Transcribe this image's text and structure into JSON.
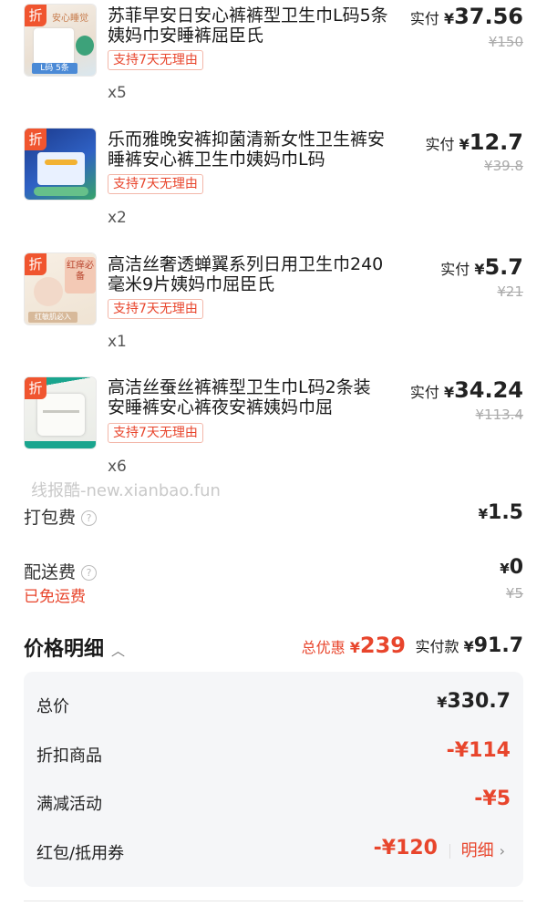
{
  "items": [
    {
      "title": "苏菲早安日安心裤裤型卫生巾L码5条姨妈巾安睡裤屈臣氏",
      "tag": "支持7天无理由",
      "qty": "x5",
      "paid_label": "实付",
      "currency": "¥",
      "paid": "37.56",
      "original": "¥150",
      "badge": "折",
      "thumb_text": "安心睡觉",
      "thumb_sub": "L码 5条"
    },
    {
      "title": "乐而雅晚安裤抑菌清新女性卫生裤安睡裤安心裤卫生巾姨妈巾L码",
      "tag": "支持7天无理由",
      "qty": "x2",
      "paid_label": "实付",
      "currency": "¥",
      "paid": "12.7",
      "original": "¥39.8",
      "badge": "折",
      "thumb_text": "",
      "thumb_sub": ""
    },
    {
      "title": "高洁丝奢透蝉翼系列日用卫生巾240毫米9片姨妈巾屈臣氏",
      "tag": "支持7天无理由",
      "qty": "x1",
      "paid_label": "实付",
      "currency": "¥",
      "paid": "5.7",
      "original": "¥21",
      "badge": "折",
      "thumb_text": "红痒必备",
      "thumb_sub": "红敏肌必入"
    },
    {
      "title": "高洁丝蚕丝裤裤型卫生巾L码2条装 安睡裤安心裤夜安裤姨妈巾屈",
      "tag": "支持7天无理由",
      "qty": "x6",
      "paid_label": "实付",
      "currency": "¥",
      "paid": "34.24",
      "original": "¥113.4",
      "badge": "折",
      "thumb_text": "",
      "thumb_sub": ""
    }
  ],
  "watermark": "线报酷-new.xianbao.fun",
  "packing_fee": {
    "label": "打包费",
    "currency": "¥",
    "value": "1.5"
  },
  "delivery_fee": {
    "label": "配送费",
    "currency": "¥",
    "value": "0",
    "original": "¥5",
    "note": "已免运费"
  },
  "help_icon": "help-circle-icon",
  "price_detail": {
    "title": "价格明细",
    "total_discount_label": "总优惠",
    "total_discount_currency": "¥",
    "total_discount": "239",
    "paid_label": "实付款",
    "paid_currency": "¥",
    "paid": "91.7"
  },
  "breakdown": {
    "total_label": "总价",
    "total_value": "330.7",
    "discount_goods_label": "折扣商品",
    "discount_goods_value": "-¥114",
    "promo_label": "满减活动",
    "promo_value": "-¥5",
    "coupon_label": "红包/抵用券",
    "coupon_value": "-¥120",
    "detail_link": "明细",
    "currency": "¥"
  },
  "colors": {
    "accent": "#e8452c",
    "badge": "#f0552f",
    "panel": "#f5f6f8"
  }
}
